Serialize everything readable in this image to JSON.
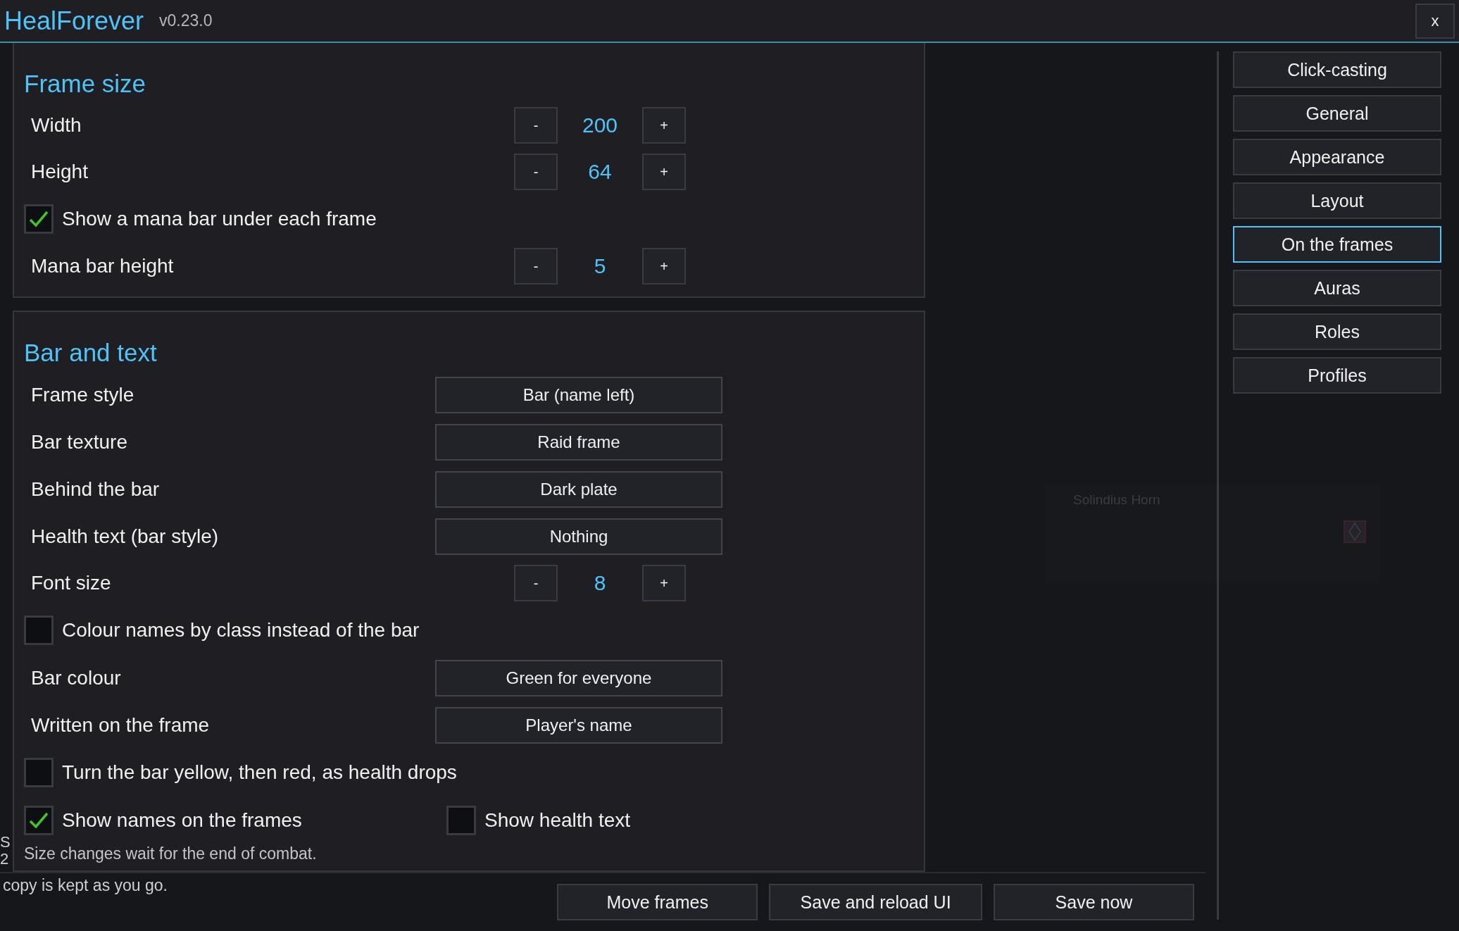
{
  "window": {
    "title": "HealForever",
    "version": "v0.23.0",
    "close": "x"
  },
  "panels": [
    {
      "heading": "Frame size",
      "rows": [
        {
          "kind": "stepper",
          "label": "Width",
          "value": "200",
          "minus": "-",
          "plus": "+"
        },
        {
          "kind": "stepper",
          "label": "Height",
          "value": "64",
          "minus": "-",
          "plus": "+"
        },
        {
          "kind": "checkbox",
          "label": "Show a mana bar under each frame",
          "checked": true
        },
        {
          "kind": "stepper",
          "label": "Mana bar height",
          "value": "5",
          "minus": "-",
          "plus": "+"
        }
      ]
    },
    {
      "heading": "Bar and text",
      "rows": [
        {
          "kind": "dropdown",
          "label": "Frame style",
          "value": "Bar (name left)"
        },
        {
          "kind": "dropdown",
          "label": "Bar texture",
          "value": "Raid frame"
        },
        {
          "kind": "dropdown",
          "label": "Behind the bar",
          "value": "Dark plate"
        },
        {
          "kind": "dropdown",
          "label": "Health text (bar style)",
          "value": "Nothing"
        },
        {
          "kind": "stepper",
          "label": "Font size",
          "value": "8",
          "minus": "-",
          "plus": "+"
        },
        {
          "kind": "checkbox",
          "label": "Colour names by class instead of the bar",
          "checked": false
        },
        {
          "kind": "dropdown",
          "label": "Bar colour",
          "value": "Green for everyone"
        },
        {
          "kind": "dropdown",
          "label": "Written on the frame",
          "value": "Player's name"
        },
        {
          "kind": "checkbox",
          "label": "Turn the bar yellow, then red, as health drops",
          "checked": false
        },
        {
          "kind": "pair",
          "items": [
            {
              "label": "Show names on the frames",
              "checked": true
            },
            {
              "label": "Show health text",
              "checked": false
            }
          ]
        }
      ],
      "note": "Size changes wait for the end of combat."
    }
  ],
  "background_note": {
    "fragments": [
      "S",
      "2"
    ],
    "line": "copy is kept as you go."
  },
  "preview_frame": {
    "name": "Solindius Horn"
  },
  "sidebar": {
    "items": [
      {
        "label": "Click-casting",
        "selected": false
      },
      {
        "label": "General",
        "selected": false
      },
      {
        "label": "Appearance",
        "selected": false
      },
      {
        "label": "Layout",
        "selected": false
      },
      {
        "label": "On the frames",
        "selected": true
      },
      {
        "label": "Auras",
        "selected": false
      },
      {
        "label": "Roles",
        "selected": false
      },
      {
        "label": "Profiles",
        "selected": false
      }
    ]
  },
  "footer": {
    "buttons": [
      "Move frames",
      "Save and reload UI",
      "Save now"
    ]
  }
}
